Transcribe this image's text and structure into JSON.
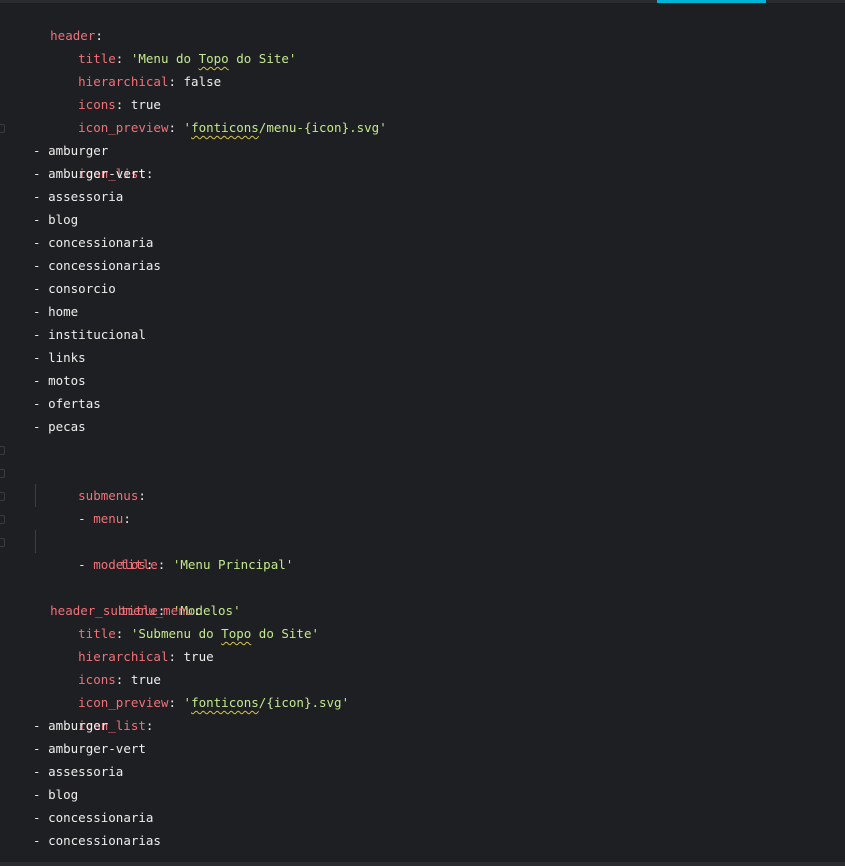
{
  "editor": {
    "accent": "#00b4d8",
    "colors": {
      "key": "#f07178",
      "string": "#c3e88d",
      "text": "#eeeeee",
      "background": "#1e1f22"
    },
    "header": {
      "key": "header",
      "title_key": "title",
      "title_open": "'Menu do ",
      "title_squig": "Topo",
      "title_close": " do Site'",
      "hierarchical_key": "hierarchical",
      "hierarchical_val": "false",
      "icons_key": "icons",
      "icons_val": "true",
      "icon_preview_key": "icon_preview",
      "icon_preview_open": "'",
      "icon_preview_squig": "fonticons",
      "icon_preview_rest": "/menu-{icon}.svg'",
      "icon_list_key": "icon_list",
      "icons": [
        "amburger",
        "amburger-vert",
        "assessoria",
        "blog",
        "concessionaria",
        "concessionarias",
        "consorcio",
        "home",
        "institucional",
        "links",
        "motos",
        "ofertas",
        "pecas"
      ],
      "submenus_key": "submenus",
      "sub1_key": "menu",
      "sub1_title_key": "title",
      "sub1_title_val": "'Menu Principal'",
      "sub2_key": "modelos",
      "sub2_title_key": "title",
      "sub2_title_val": "'Modelos'"
    },
    "submenu": {
      "key": "header_submenu_menu",
      "title_key": "title",
      "title_open": "'Submenu do ",
      "title_squig": "Topo",
      "title_close": " do Site'",
      "hierarchical_key": "hierarchical",
      "hierarchical_val": "true",
      "icons_key": "icons",
      "icons_val": "true",
      "icon_preview_key": "icon_preview",
      "icon_preview_open": "'",
      "icon_preview_squig": "fonticons",
      "icon_preview_rest": "/{icon}.svg'",
      "icon_list_key": "icon_list",
      "icons": [
        "amburger",
        "amburger-vert",
        "assessoria",
        "blog",
        "concessionaria",
        "concessionarias"
      ]
    }
  }
}
